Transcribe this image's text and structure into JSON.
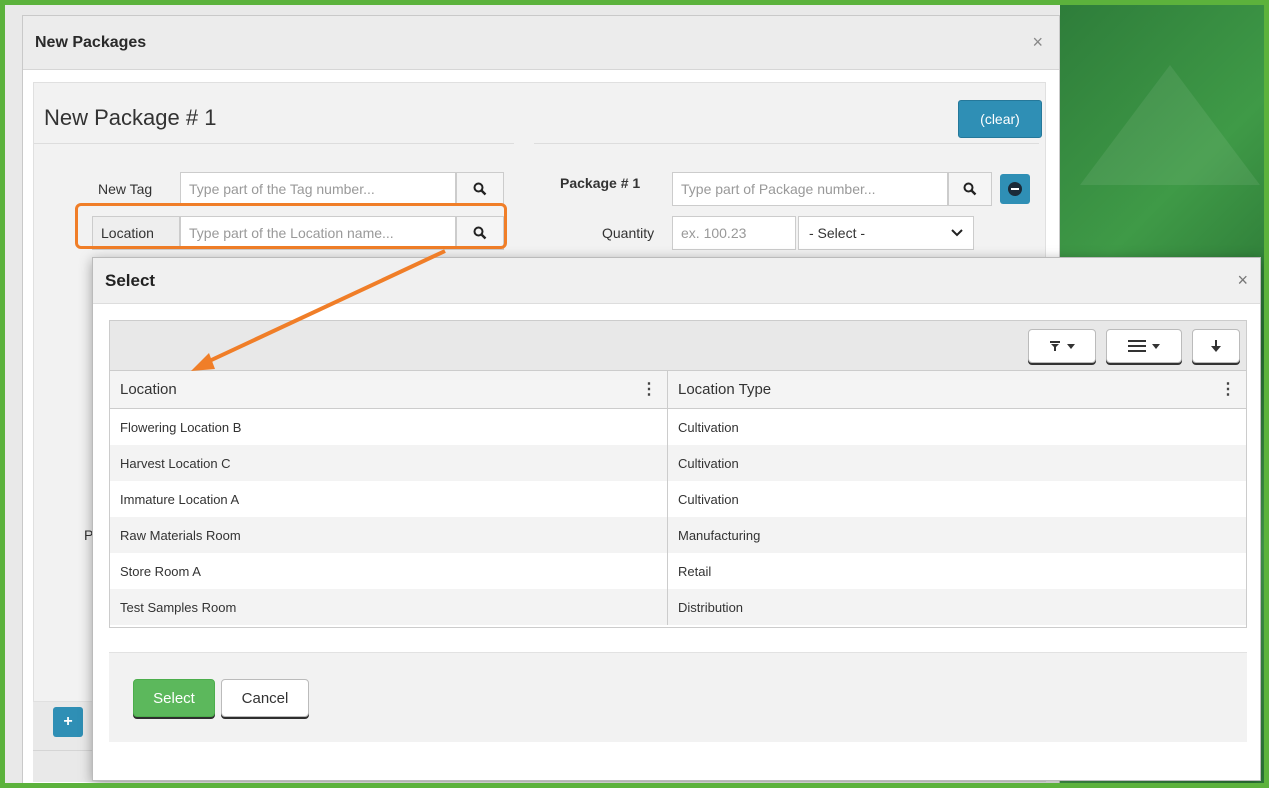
{
  "outer_window": {
    "title": "New Packages",
    "close": "×"
  },
  "package_form": {
    "title": "New Package # 1",
    "clear_label": "(clear)",
    "new_tag_label": "New Tag",
    "new_tag_placeholder": "Type part of the Tag number...",
    "location_label": "Location",
    "location_placeholder": "Type part of the Location name...",
    "package_label": "Package # 1",
    "package_placeholder": "Type part of Package number...",
    "quantity_label": "Quantity",
    "quantity_placeholder": "ex. 100.23",
    "unit_select": "- Select -",
    "pack_partial": "Pack",
    "add_label": "+"
  },
  "select_modal": {
    "title": "Select",
    "close": "×",
    "columns": [
      "Location",
      "Location Type"
    ],
    "rows": [
      [
        "Flowering Location B",
        "Cultivation"
      ],
      [
        "Harvest Location C",
        "Cultivation"
      ],
      [
        "Immature Location A",
        "Cultivation"
      ],
      [
        "Raw Materials Room",
        "Manufacturing"
      ],
      [
        "Store Room A",
        "Retail"
      ],
      [
        "Test Samples Room",
        "Distribution"
      ]
    ],
    "select_label": "Select",
    "cancel_label": "Cancel"
  },
  "colors": {
    "accent_blue": "#2f8fb5",
    "select_green": "#5cb85c",
    "highlight_orange": "#f07e28",
    "frame_green": "#5cb23c"
  },
  "icons": [
    "search-icon",
    "minus-circle-icon",
    "filter-icon",
    "columns-menu-icon",
    "download-icon",
    "kebab-icon",
    "chevron-down-icon",
    "plus-icon",
    "close-icon"
  ]
}
